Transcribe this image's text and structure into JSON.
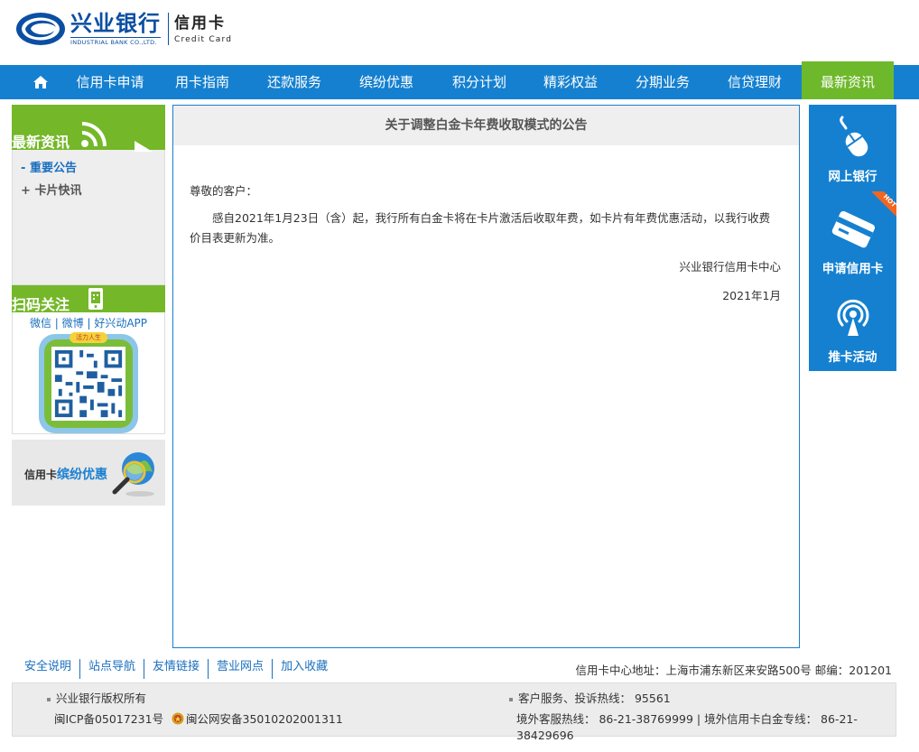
{
  "header": {
    "logo_cn": "兴业银行",
    "logo_en": "INDUSTRIAL BANK CO.,LTD.",
    "sub_cn": "信用卡",
    "sub_en": "Credit Card"
  },
  "nav": {
    "home_icon": "home-icon",
    "items": [
      "信用卡申请",
      "用卡指南",
      "还款服务",
      "缤纷优惠",
      "积分计划",
      "精彩权益",
      "分期业务",
      "信贷理财",
      "最新资讯"
    ],
    "active_index": 8,
    "colors": {
      "bar": "#1580d0",
      "active": "#6eb92b"
    }
  },
  "left": {
    "news_title": "最新资讯",
    "news_links": [
      {
        "prefix": "-",
        "label": "重要公告"
      },
      {
        "prefix": "+",
        "label": "卡片快讯"
      }
    ],
    "qr_title": "扫码关注",
    "qr_links": "微信 | 微博 | 好兴动APP",
    "qr_badge": "活力人生",
    "promo_prefix": "信用卡",
    "promo_highlight": "缤纷优惠"
  },
  "main": {
    "title": "关于调整白金卡年费收取模式的公告",
    "greeting": "尊敬的客户：",
    "content": "感自2021年1月23日（含）起，我行所有白金卡将在卡片激活后收取年费，如卡片有年费优惠活动，以我行收费价目表更新为准。",
    "signature": "兴业银行信用卡中心",
    "date": "2021年1月"
  },
  "right": {
    "items": [
      "网上银行",
      "申请信用卡",
      "推卡活动"
    ],
    "hot_badge": "HOT"
  },
  "footer": {
    "links": [
      "安全说明",
      "站点导航",
      "友情链接",
      "营业网点",
      "加入收藏"
    ],
    "address": "信用卡中心地址：上海市浦东新区来安路500号 邮编：201201",
    "copyright": "兴业银行版权所有",
    "icp": "闽ICP备05017231号",
    "police": "闽公网安备35010202001311",
    "hotline": "客户服务、投诉热线：  95561",
    "overseas": "境外客服热线：  86-21-38769999 | 境外信用卡白金专线：  86-21-38429696"
  }
}
